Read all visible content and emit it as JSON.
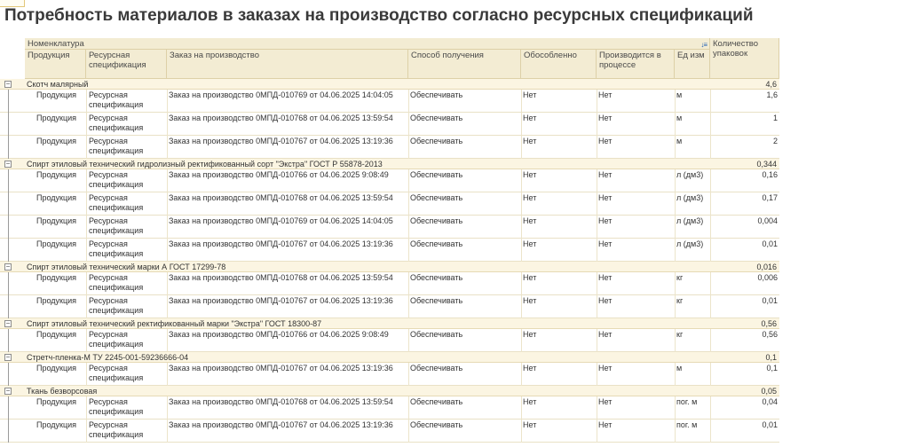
{
  "title": "Потребность материалов в заказах на производство согласно ресурсных спецификаций",
  "columns": {
    "nomenclature": "Номенклатура",
    "product": "Продукция",
    "spec": "Ресурсная спецификация",
    "order": "Заказ на производство",
    "method": "Способ получения",
    "separate": "Обособленно",
    "in_process": "Производится в процессе",
    "unit": "Ед изм",
    "quantity": "Количество упаковок"
  },
  "groups": [
    {
      "name": "Скотч малярный",
      "total": "4,6",
      "rows": [
        {
          "product": "Продукция",
          "spec": "Ресурсная спецификация",
          "order": "Заказ на производство 0МПД-010769 от 04.06.2025 14:04:05",
          "method": "Обеспечивать",
          "separate": "Нет",
          "in_process": "Нет",
          "unit": "м",
          "qty": "1,6"
        },
        {
          "product": "Продукция",
          "spec": "Ресурсная спецификация",
          "order": "Заказ на производство 0МПД-010768 от 04.06.2025 13:59:54",
          "method": "Обеспечивать",
          "separate": "Нет",
          "in_process": "Нет",
          "unit": "м",
          "qty": "1"
        },
        {
          "product": "Продукция",
          "spec": "Ресурсная спецификация",
          "order": "Заказ на производство 0МПД-010767 от 04.06.2025 13:19:36",
          "method": "Обеспечивать",
          "separate": "Нет",
          "in_process": "Нет",
          "unit": "м",
          "qty": "2"
        }
      ]
    },
    {
      "name": "Спирт этиловый технический гидролизный ректификованный сорт \"Экстра\" ГОСТ Р 55878-2013",
      "total": "0,344",
      "rows": [
        {
          "product": "Продукция",
          "spec": "Ресурсная спецификация",
          "order": "Заказ на производство 0МПД-010766 от 04.06.2025 9:08:49",
          "method": "Обеспечивать",
          "separate": "Нет",
          "in_process": "Нет",
          "unit": "л (дм3)",
          "qty": "0,16"
        },
        {
          "product": "Продукция",
          "spec": "Ресурсная спецификация",
          "order": "Заказ на производство 0МПД-010768 от 04.06.2025 13:59:54",
          "method": "Обеспечивать",
          "separate": "Нет",
          "in_process": "Нет",
          "unit": "л (дм3)",
          "qty": "0,17"
        },
        {
          "product": "Продукция",
          "spec": "Ресурсная спецификация",
          "order": "Заказ на производство 0МПД-010769 от 04.06.2025 14:04:05",
          "method": "Обеспечивать",
          "separate": "Нет",
          "in_process": "Нет",
          "unit": "л (дм3)",
          "qty": "0,004"
        },
        {
          "product": "Продукция",
          "spec": "Ресурсная спецификация",
          "order": "Заказ на производство 0МПД-010767 от 04.06.2025 13:19:36",
          "method": "Обеспечивать",
          "separate": "Нет",
          "in_process": "Нет",
          "unit": "л (дм3)",
          "qty": "0,01"
        }
      ]
    },
    {
      "name": "Спирт этиловый технический марки А ГОСТ 17299-78",
      "total": "0,016",
      "rows": [
        {
          "product": "Продукция",
          "spec": "Ресурсная спецификация",
          "order": "Заказ на производство 0МПД-010768 от 04.06.2025 13:59:54",
          "method": "Обеспечивать",
          "separate": "Нет",
          "in_process": "Нет",
          "unit": "кг",
          "qty": "0,006"
        },
        {
          "product": "Продукция",
          "spec": "Ресурсная спецификация",
          "order": "Заказ на производство 0МПД-010767 от 04.06.2025 13:19:36",
          "method": "Обеспечивать",
          "separate": "Нет",
          "in_process": "Нет",
          "unit": "кг",
          "qty": "0,01"
        }
      ]
    },
    {
      "name": "Спирт этиловый технический ректификованный марки \"Экстра\" ГОСТ 18300-87",
      "total": "0,56",
      "rows": [
        {
          "product": "Продукция",
          "spec": "Ресурсная спецификация",
          "order": "Заказ на производство 0МПД-010766 от 04.06.2025 9:08:49",
          "method": "Обеспечивать",
          "separate": "Нет",
          "in_process": "Нет",
          "unit": "кг",
          "qty": "0,56"
        }
      ]
    },
    {
      "name": "Стретч-пленка-М  ТУ 2245-001-59236666-04",
      "total": "0,1",
      "rows": [
        {
          "product": "Продукция",
          "spec": "Ресурсная спецификация",
          "order": "Заказ на производство 0МПД-010767 от 04.06.2025 13:19:36",
          "method": "Обеспечивать",
          "separate": "Нет",
          "in_process": "Нет",
          "unit": "м",
          "qty": "0,1"
        }
      ]
    },
    {
      "name": "Ткань безворсовая",
      "total": "0,05",
      "rows": [
        {
          "product": "Продукция",
          "spec": "Ресурсная спецификация",
          "order": "Заказ на производство 0МПД-010768 от 04.06.2025 13:59:54",
          "method": "Обеспечивать",
          "separate": "Нет",
          "in_process": "Нет",
          "unit": "пог. м",
          "qty": "0,04"
        },
        {
          "product": "Продукция",
          "spec": "Ресурсная спецификация",
          "order": "Заказ на производство 0МПД-010767 от 04.06.2025 13:19:36",
          "method": "Обеспечивать",
          "separate": "Нет",
          "in_process": "Нет",
          "unit": "пог. м",
          "qty": "0,01"
        }
      ]
    }
  ],
  "icons": {
    "collapse": "minus-square-icon",
    "sort": "sort-icon"
  }
}
